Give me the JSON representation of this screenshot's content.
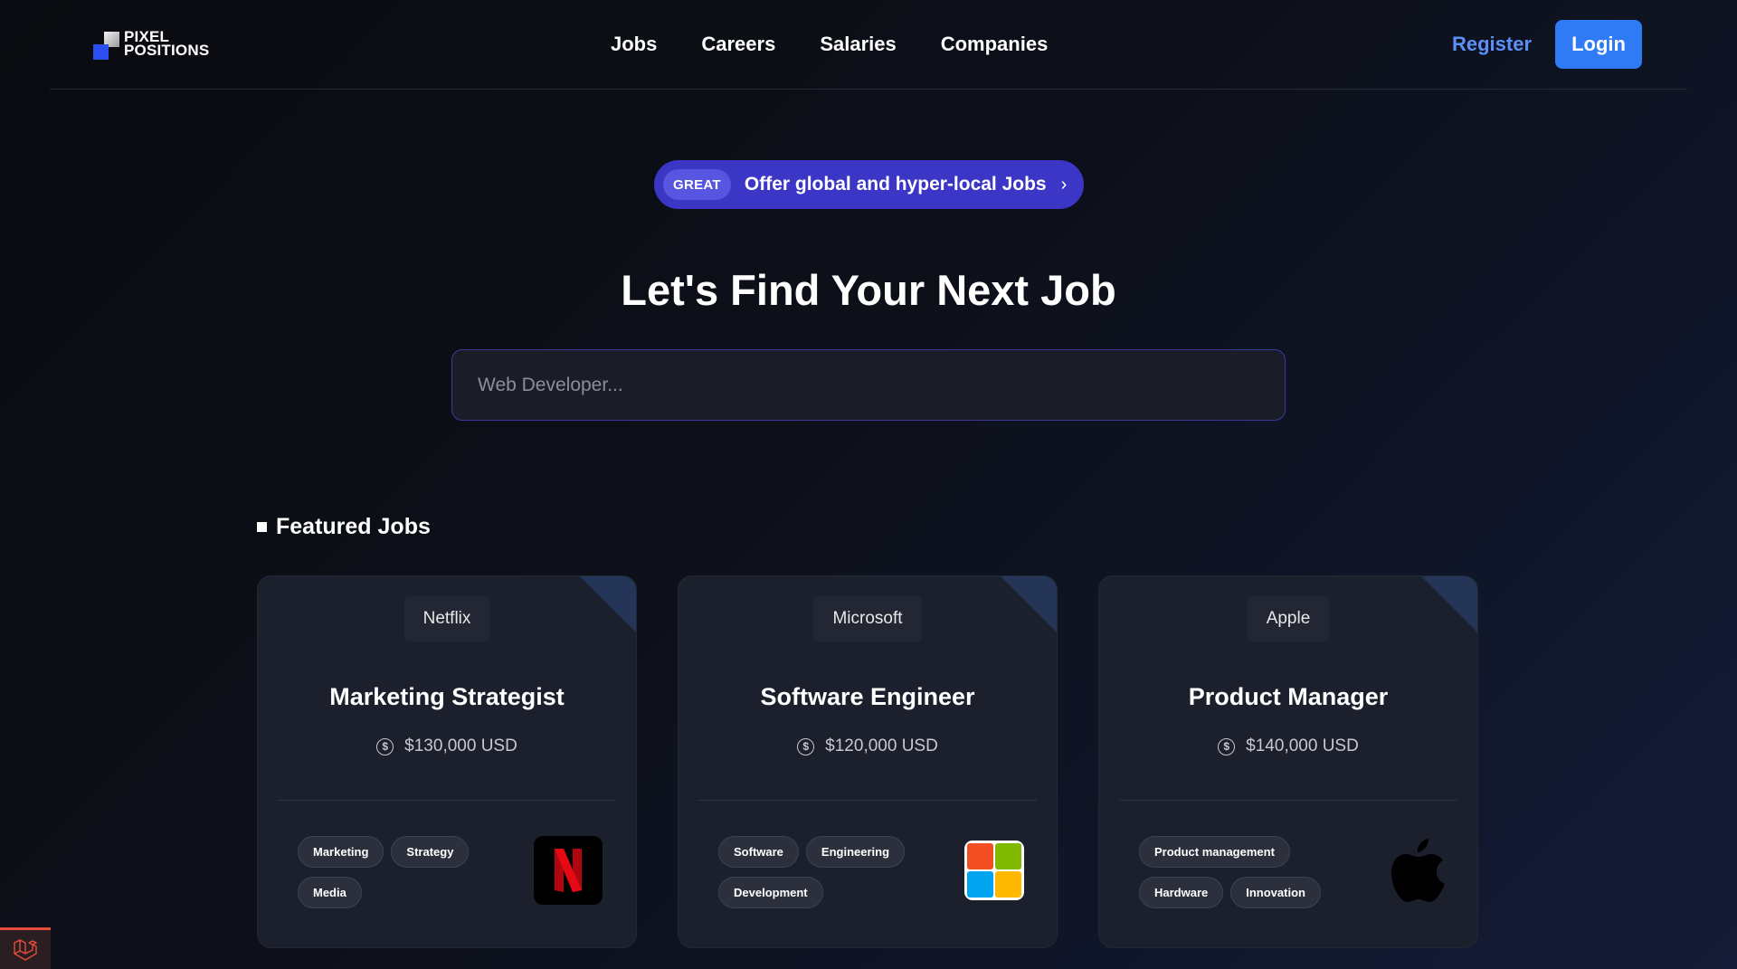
{
  "brand": {
    "line1": "PIXEL",
    "line2": "POSITIONS"
  },
  "nav": {
    "links": [
      "Jobs",
      "Careers",
      "Salaries",
      "Companies"
    ],
    "register_label": "Register",
    "login_label": "Login"
  },
  "announcement": {
    "badge": "GREAT",
    "text": "Offer global and hyper-local Jobs",
    "chevron": "›"
  },
  "hero": {
    "title": "Let's Find Your Next Job",
    "search_placeholder": "Web Developer..."
  },
  "featured": {
    "title": "Featured Jobs",
    "jobs": [
      {
        "company": "Netflix",
        "title": "Marketing Strategist",
        "salary": "$130,000 USD",
        "tags": [
          "Marketing",
          "Strategy",
          "Media"
        ],
        "logo_icon": "netflix-logo-icon"
      },
      {
        "company": "Microsoft",
        "title": "Software Engineer",
        "salary": "$120,000 USD",
        "tags": [
          "Software",
          "Engineering",
          "Development"
        ],
        "logo_icon": "microsoft-logo-icon"
      },
      {
        "company": "Apple",
        "title": "Product Manager",
        "salary": "$140,000 USD",
        "tags": [
          "Product management",
          "Hardware",
          "Innovation"
        ],
        "logo_icon": "apple-logo-icon"
      }
    ]
  },
  "colors": {
    "accent_blue": "#2f7af5",
    "register_blue": "#5c8ff7",
    "pill_purple": "#3c36c6",
    "card_bg": "#1c202c"
  }
}
